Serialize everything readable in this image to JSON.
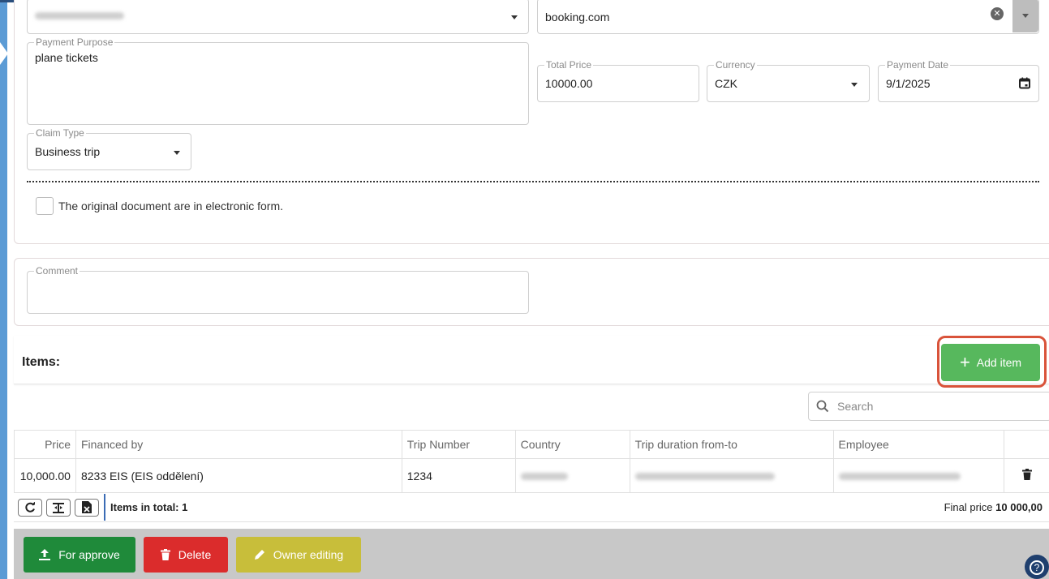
{
  "form": {
    "supplier_select": {
      "value_blurred": "Valbonal Inna (2028)"
    },
    "vendor": {
      "value": "booking.com",
      "clear_icon": "close-circle-icon"
    },
    "payment_purpose": {
      "label": "Payment Purpose",
      "value": "plane tickets"
    },
    "total_price": {
      "label": "Total Price",
      "value": "10000.00"
    },
    "currency": {
      "label": "Currency",
      "value": "CZK"
    },
    "payment_date": {
      "label": "Payment Date",
      "value": "9/1/2025",
      "icon": "calendar-icon"
    },
    "claim_type": {
      "label": "Claim Type",
      "value": "Business trip"
    },
    "electronic_checkbox": {
      "label": "The original document are in electronic form.",
      "checked": false
    },
    "comment": {
      "label": "Comment",
      "value": ""
    }
  },
  "items": {
    "title": "Items:",
    "add_button": "Add item",
    "search_placeholder": "Search",
    "columns": [
      "Price",
      "Financed by",
      "Trip Number",
      "Country",
      "Trip duration from-to",
      "Employee"
    ],
    "rows": [
      {
        "price": "10,000.00",
        "financed_by": "8233 EIS (EIS oddělení)",
        "trip_number": "1234",
        "country_blurred": "Malaysia",
        "duration_blurred": "01. 09. 2025 - 03. 09. 2025",
        "employee_blurred": "Hrůzová Veronika (6492)"
      }
    ],
    "footer": {
      "tools": [
        "refresh-icon",
        "column-chooser-icon",
        "excel-export-icon"
      ],
      "items_in_total": "Items in total: 1",
      "final_price_label": "Final price",
      "final_price_value": "10 000,00"
    }
  },
  "actions": {
    "approve": "For approve",
    "delete": "Delete",
    "owner_editing": "Owner editing"
  },
  "colors": {
    "accent_blue": "#5b9bd5",
    "add_green": "#57b85d",
    "approve_green": "#1f8a3a",
    "delete_red": "#db2c2c",
    "owner_yellow": "#c8be3a",
    "highlight_outline": "#d9533a"
  }
}
